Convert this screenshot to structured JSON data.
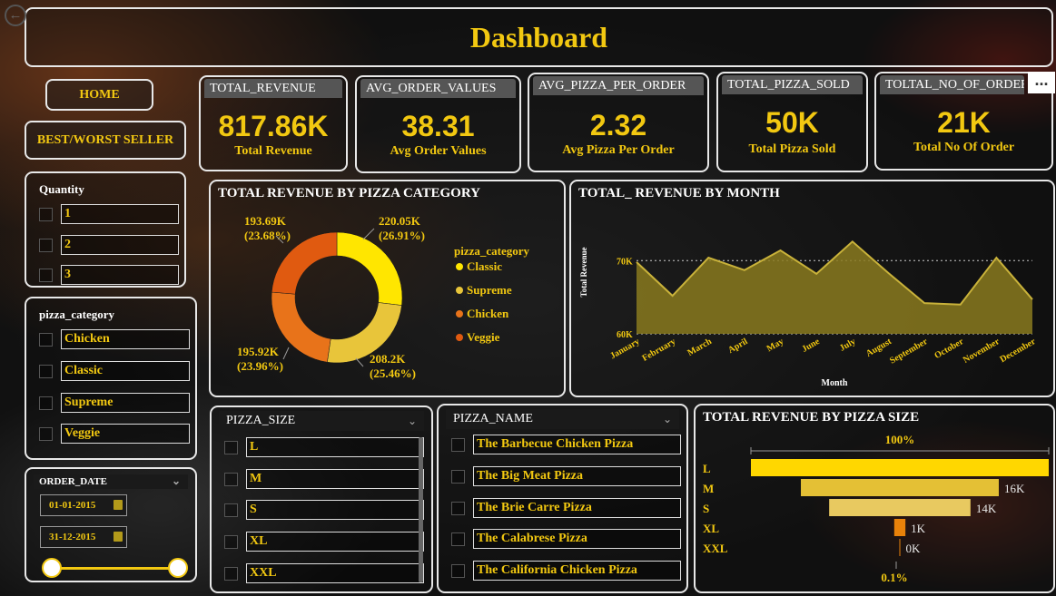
{
  "header": {
    "title": "Dashboard",
    "back_icon": "back-arrow-icon"
  },
  "nav": {
    "home": "HOME",
    "best_worst": "BEST/WORST SELLER"
  },
  "kpis": [
    {
      "title": "TOTAL_REVENUE",
      "value": "817.86K",
      "label": "Total Revenue"
    },
    {
      "title": "AVG_ORDER_VALUES",
      "value": "38.31",
      "label": "Avg Order Values"
    },
    {
      "title": "AVG_PIZZA_PER_ORDER",
      "value": "2.32",
      "label": "Avg Pizza Per Order"
    },
    {
      "title": "TOTAL_PIZZA_SOLD",
      "value": "50K",
      "label": "Total Pizza Sold"
    },
    {
      "title": "TOLTAL_NO_OF_ORDER",
      "value": "21K",
      "label": "Total No Of Order"
    }
  ],
  "more_icon": "...",
  "quantity_slicer": {
    "title": "Quantity",
    "items": [
      "1",
      "2",
      "3"
    ]
  },
  "category_slicer": {
    "title": "pizza_category",
    "items": [
      "Chicken",
      "Classic",
      "Supreme",
      "Veggie"
    ]
  },
  "date_slicer": {
    "title": "ORDER_DATE",
    "start": "01-01-2015",
    "end": "31-12-2015"
  },
  "size_slicer": {
    "title": "PIZZA_SIZE",
    "items": [
      "L",
      "M",
      "S",
      "XL",
      "XXL"
    ]
  },
  "name_slicer": {
    "title": "PIZZA_NAME",
    "items": [
      "The Barbecue Chicken Pizza",
      "The Big Meat Pizza",
      "The Brie Carre Pizza",
      "The Calabrese Pizza",
      "The California Chicken Pizza"
    ]
  },
  "colors": {
    "accent": "#f2c811",
    "classic": "#ffe600",
    "supreme": "#e8c53a",
    "chicken": "#e8731a",
    "veggie": "#e05a10",
    "area": "#8a7a1f",
    "size_L": "#ffd700",
    "size_M": "#e4c035",
    "size_S": "#e8c960",
    "size_XL": "#e8820a"
  },
  "chart_data": [
    {
      "type": "pie",
      "title": "TOTAL REVENUE BY PIZZA CATEGORY",
      "legend_title": "pizza_category",
      "legend_position": "right",
      "categories": [
        "Classic",
        "Supreme",
        "Chicken",
        "Veggie"
      ],
      "values": [
        220.05,
        208.2,
        195.92,
        193.69
      ],
      "data_labels": [
        "220.05K\n(26.91%)",
        "208.2K\n(25.46%)",
        "195.92K\n(23.96%)",
        "193.69K\n(23.68%)"
      ],
      "donut": true
    },
    {
      "type": "area",
      "title": "TOTAL_ REVENUE BY MONTH",
      "xlabel": "Month",
      "ylabel": "Total Revenue",
      "categories": [
        "January",
        "February",
        "March",
        "April",
        "May",
        "June",
        "July",
        "August",
        "September",
        "October",
        "November",
        "December"
      ],
      "values": [
        69.8,
        65.2,
        70.4,
        68.7,
        71.4,
        68.2,
        72.6,
        68.3,
        64.2,
        64.0,
        70.4,
        64.7
      ],
      "ylim": [
        60,
        74
      ],
      "yticks": [
        "60K",
        "70K"
      ],
      "grid": "dotted at ticks"
    },
    {
      "type": "bar",
      "title": "TOTAL REVENUE BY PIZZA SIZE",
      "orientation": "funnel",
      "categories": [
        "L",
        "M",
        "S",
        "XL",
        "XXL"
      ],
      "values": [
        375.3,
        249.4,
        178.1,
        14.1,
        1.0
      ],
      "data_labels": [
        "",
        "16K",
        "14K",
        "1K",
        "0K"
      ],
      "top_label": "100%",
      "bottom_label": "0.1%"
    }
  ]
}
